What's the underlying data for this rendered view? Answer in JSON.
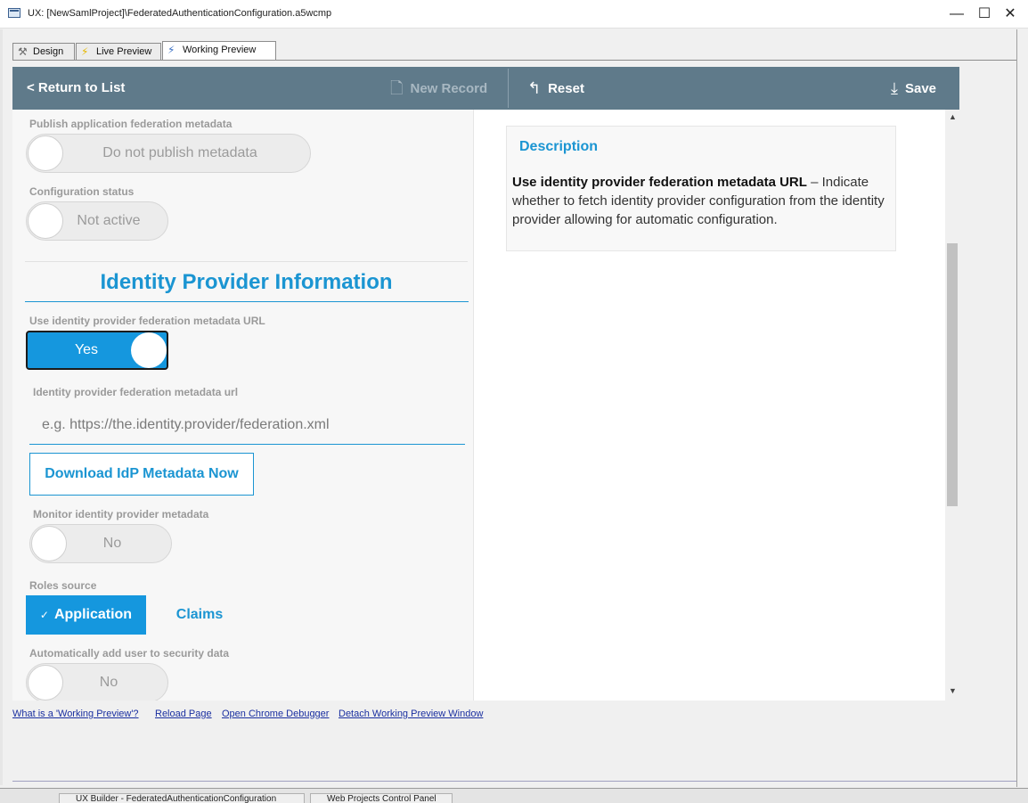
{
  "window": {
    "title": "UX: [NewSamlProject]\\FederatedAuthenticationConfiguration.a5wcmp",
    "minimize_glyph": "—",
    "maximize_glyph": "☐",
    "close_glyph": "✕"
  },
  "tabs": [
    {
      "label": "Design",
      "icon": "design-tools-icon",
      "glyph": "⚒"
    },
    {
      "label": "Live Preview",
      "icon": "lightning-icon",
      "glyph": "⚡"
    },
    {
      "label": "Working Preview",
      "icon": "lightning-icon",
      "glyph": "⚡",
      "active": true
    }
  ],
  "toolbar": {
    "return_label": "< Return to List",
    "new_record_label": "New Record",
    "new_record_glyph": "🗋",
    "reset_label": "Reset",
    "reset_glyph": "↰",
    "save_label": "Save",
    "save_glyph": "⤓"
  },
  "form": {
    "publish_label": "Publish application federation metadata",
    "publish_value": "Do not publish metadata",
    "config_status_label": "Configuration status",
    "config_status_value": "Not active",
    "section_title": "Identity Provider Information",
    "use_metadata_url_label": "Use identity provider federation metadata URL",
    "use_metadata_url_value": "Yes",
    "metadata_url_label": "Identity provider federation metadata url",
    "metadata_url_placeholder": "e.g. https://the.identity.provider/federation.xml",
    "download_button": "Download IdP Metadata Now",
    "monitor_label": "Monitor identity provider metadata",
    "monitor_value": "No",
    "roles_source_label": "Roles source",
    "roles_source_options": [
      "Application",
      "Claims"
    ],
    "roles_source_selected": "Application",
    "auto_add_label": "Automatically add user to security data",
    "auto_add_value": "No"
  },
  "description": {
    "title": "Description",
    "term": "Use identity provider federation metadata URL",
    "dash": " – ",
    "text": "Indicate whether to fetch identity provider configuration from the identity provider allowing for automatic configuration."
  },
  "footer_links": [
    "What is a 'Working Preview'?",
    "Reload Page",
    "Open Chrome Debugger",
    "Detach Working Preview Window"
  ],
  "taskbar": [
    "UX Builder - FederatedAuthenticationConfiguration",
    "Web Projects Control Panel"
  ],
  "colors": {
    "accent": "#1b95d2",
    "toolbar": "#5f7a8a",
    "toggle_on": "#1597de"
  }
}
